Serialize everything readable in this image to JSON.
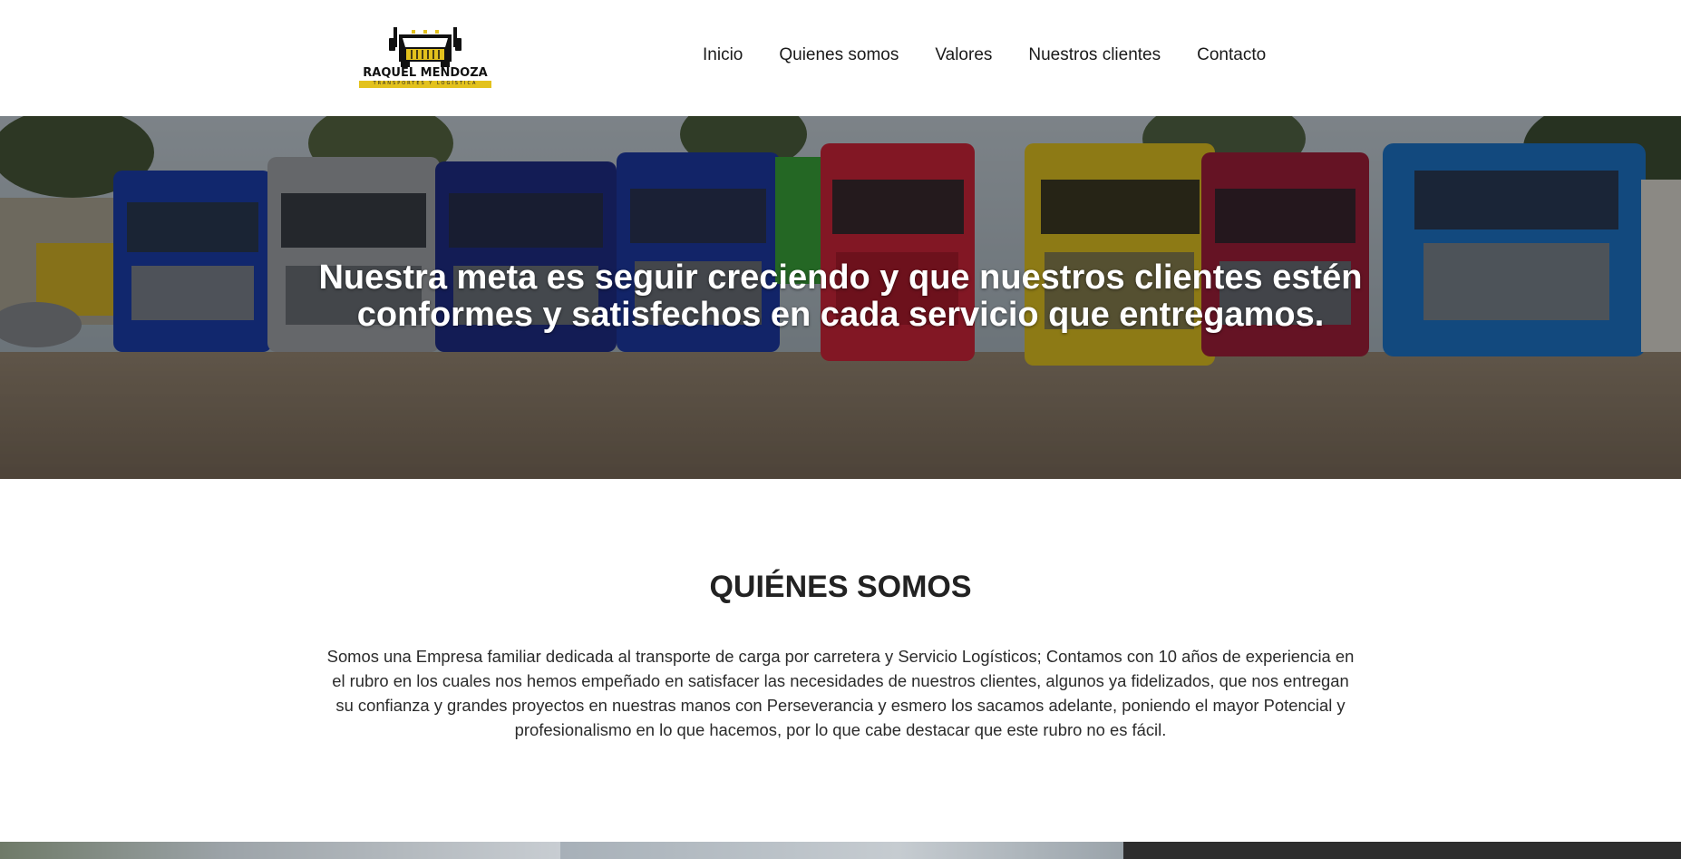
{
  "header": {
    "logo": {
      "name": "RAQUEL MENDOZA",
      "tagline": "TRANSPORTES Y LOGÍSTICA",
      "icon": "truck-front-icon",
      "accent_color": "#e3c21d"
    },
    "nav": [
      {
        "label": "Inicio"
      },
      {
        "label": "Quienes somos"
      },
      {
        "label": "Valores"
      },
      {
        "label": "Nuestros clientes"
      },
      {
        "label": "Contacto"
      }
    ]
  },
  "hero": {
    "title": "Nuestra meta es seguir creciendo y que nuestros clientes estén conformes y satisfechos en cada servicio que entregamos.",
    "image": "fleet-of-trucks-photo"
  },
  "about": {
    "title": "QUIÉNES SOMOS",
    "text": "Somos una Empresa familiar dedicada al transporte de carga por carretera y Servicio Logísticos; Contamos con 10 años de experiencia en el rubro en los cuales nos hemos empeñado en satisfacer las necesidades de nuestros clientes, algunos ya fidelizados, que nos entregan su confianza y grandes proyectos en nuestras manos con Perseverancia y esmero los sacamos adelante, poniendo el mayor Potencial y profesionalismo en lo que hacemos, por lo que cabe destacar que este rubro no es fácil."
  },
  "gallery": {
    "images": [
      "highway-photo",
      "port-photo",
      "dark-photo"
    ]
  }
}
